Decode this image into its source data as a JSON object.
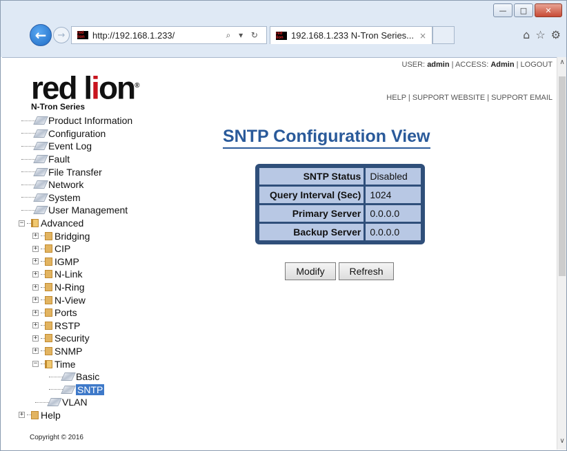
{
  "browser": {
    "url": "http://192.168.1.233/",
    "tab_title": "192.168.1.233 N-Tron Series...",
    "favicon_text": "red lion",
    "back_icon": "←",
    "forward_icon": "→",
    "search_refresh_icons": "⌕ ▾ ↻",
    "tab_close": "×",
    "minimize": "—",
    "maximize": "□",
    "close": "✕",
    "home_icon": "⌂",
    "favorites_icon": "☆",
    "settings_icon": "⚙"
  },
  "header": {
    "logo_main_a": "red l",
    "logo_main_o": "i",
    "logo_main_b": "on",
    "logo_registered": "®",
    "logo_sub": "N-Tron Series",
    "user_label": "USER:",
    "user": "admin",
    "access_label": "ACCESS:",
    "access": "Admin",
    "logout": "LOGOUT",
    "sep": "|",
    "help": "HELP",
    "support_website": "SUPPORT WEBSITE",
    "support_email": "SUPPORT EMAIL"
  },
  "tree": {
    "items": [
      {
        "label": "Product Information"
      },
      {
        "label": "Configuration"
      },
      {
        "label": "Event Log"
      },
      {
        "label": "Fault"
      },
      {
        "label": "File Transfer"
      },
      {
        "label": "Network"
      },
      {
        "label": "System"
      },
      {
        "label": "User Management"
      },
      {
        "label": "Advanced"
      },
      {
        "label": "Bridging"
      },
      {
        "label": "CIP"
      },
      {
        "label": "IGMP"
      },
      {
        "label": "N-Link"
      },
      {
        "label": "N-Ring"
      },
      {
        "label": "N-View"
      },
      {
        "label": "Ports"
      },
      {
        "label": "RSTP"
      },
      {
        "label": "Security"
      },
      {
        "label": "SNMP"
      },
      {
        "label": "Time"
      },
      {
        "label": "Basic"
      },
      {
        "label": "SNTP"
      },
      {
        "label": "VLAN"
      },
      {
        "label": "Help"
      }
    ],
    "plus": "+",
    "minus": "−"
  },
  "footer": {
    "copyright": "Copyright © 2016"
  },
  "main": {
    "title": "SNTP Configuration View",
    "rows": [
      {
        "key": "SNTP Status",
        "value": "Disabled"
      },
      {
        "key": "Query Interval (Sec)",
        "value": "1024"
      },
      {
        "key": "Primary Server",
        "value": "0.0.0.0"
      },
      {
        "key": "Backup Server",
        "value": "0.0.0.0"
      }
    ],
    "modify_label": "Modify",
    "refresh_label": "Refresh"
  },
  "scroll": {
    "up": "∧",
    "down": "∨"
  }
}
